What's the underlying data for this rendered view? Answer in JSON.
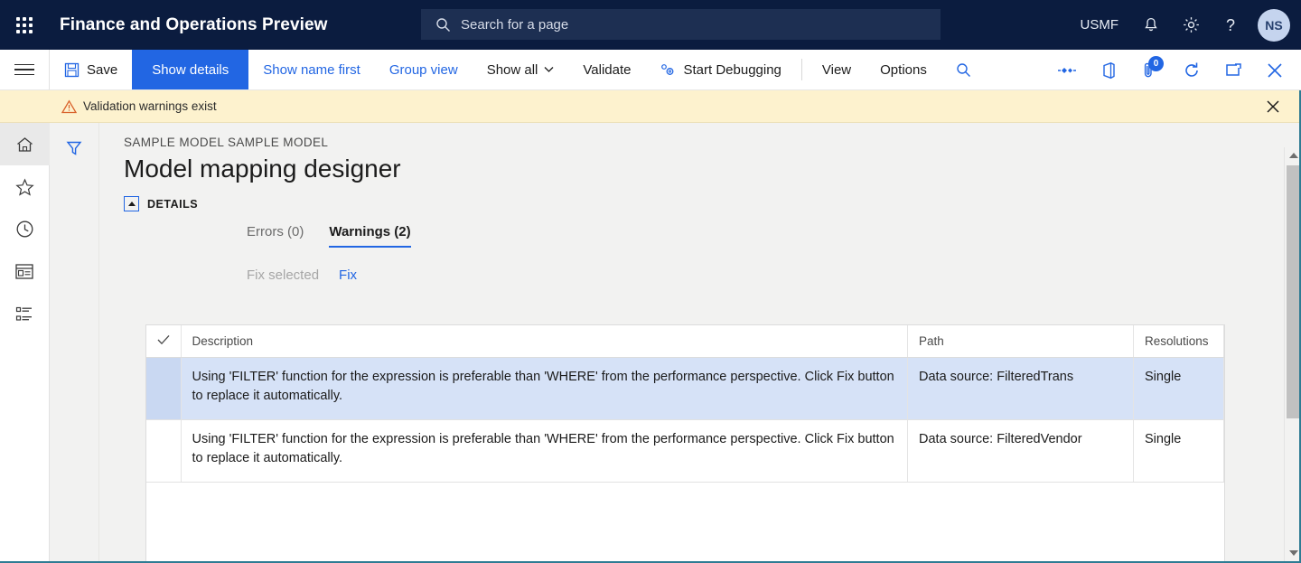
{
  "topnav": {
    "waffle_icon": "app-launcher-icon",
    "app_title": "Finance and Operations Preview",
    "search": {
      "placeholder": "Search for a page",
      "icon": "search-icon"
    },
    "company": "USMF",
    "notifications_icon": "bell-icon",
    "settings_icon": "gear-icon",
    "help_icon": "question-mark-icon",
    "avatar_initials": "NS"
  },
  "commandbar": {
    "menu_icon": "hamburger-icon",
    "save_label": "Save",
    "save_icon": "save-disk-icon",
    "show_details_label": "Show details",
    "show_name_first_label": "Show name first",
    "group_view_label": "Group view",
    "show_all_label": "Show all",
    "validate_label": "Validate",
    "start_debugging_label": "Start Debugging",
    "view_label": "View",
    "options_label": "Options",
    "search_icon": "search-icon",
    "right_icons": {
      "flow_icon": "power-apps-flow-icon",
      "office_icon": "open-in-office-icon",
      "attachments_icon": "attachment-icon",
      "attachments_count": "0",
      "refresh_icon": "refresh-icon",
      "popout_icon": "open-new-window-icon",
      "close_icon": "close-icon"
    }
  },
  "messagebar": {
    "icon": "warning-triangle-icon",
    "text": "Validation warnings exist",
    "close_icon": "close-icon"
  },
  "railnav": {
    "items": [
      {
        "name": "home",
        "icon": "home-icon",
        "selected": true
      },
      {
        "name": "favorites",
        "icon": "star-icon",
        "selected": false
      },
      {
        "name": "recent",
        "icon": "clock-icon",
        "selected": false
      },
      {
        "name": "workspaces",
        "icon": "workspace-icon",
        "selected": false
      },
      {
        "name": "modules",
        "icon": "list-icon",
        "selected": false
      }
    ]
  },
  "filterpane": {
    "filter_icon": "filter-funnel-icon"
  },
  "page": {
    "breadcrumb": "SAMPLE MODEL SAMPLE MODEL",
    "title": "Model mapping designer",
    "section_label": "DETAILS",
    "section_expanded": true
  },
  "tabs": [
    {
      "label": "Errors (0)",
      "active": false
    },
    {
      "label": "Warnings (2)",
      "active": true
    }
  ],
  "actions": [
    {
      "label": "Fix selected",
      "disabled": true
    },
    {
      "label": "Fix",
      "disabled": false
    }
  ],
  "grid": {
    "columns": [
      "Description",
      "Path",
      "Resolutions"
    ],
    "select_all_icon": "checkmark-icon",
    "rows": [
      {
        "description": "Using 'FILTER' function for the expression is preferable than 'WHERE' from the performance perspective. Click Fix button to replace it automatically.",
        "path": "Data source: FilteredTrans",
        "resolutions": "Single",
        "selected": true
      },
      {
        "description": "Using 'FILTER' function for the expression is preferable than 'WHERE' from the performance perspective. Click Fix button to replace it automatically.",
        "path": "Data source: FilteredVendor",
        "resolutions": "Single",
        "selected": false
      }
    ]
  },
  "scrollbar": {
    "up_icon": "scroll-up-arrow",
    "down_icon": "scroll-down-arrow"
  },
  "colors": {
    "nav_bg": "#0b1c3f",
    "accent": "#2266e3",
    "warning_bg": "#fdf2ce",
    "selection": "#d6e2f7",
    "page_bg": "#f2f2f1"
  }
}
